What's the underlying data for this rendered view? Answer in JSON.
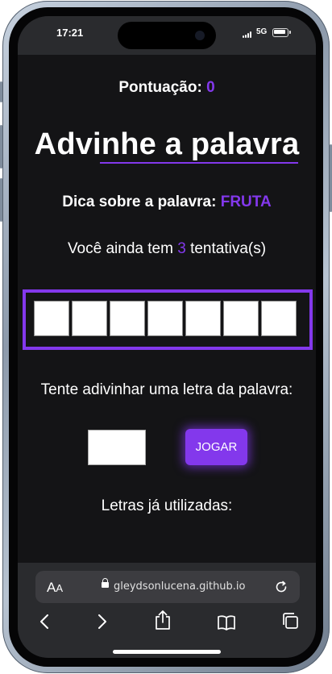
{
  "status_bar": {
    "time": "17:21",
    "network": "5G"
  },
  "game": {
    "score_label": "Pontuação:",
    "score_value": "0",
    "title": "Advinhe a palavra",
    "hint_label": "Dica sobre a palavra:",
    "hint_value": "FRUTA",
    "tries_prefix": "Você ainda tem",
    "tries_count": "3",
    "tries_suffix": "tentativa(s)",
    "word_length": 7,
    "guess_prompt": "Tente adivinhar uma letra da palavra:",
    "letter_input_value": "",
    "play_button": "JOGAR",
    "used_letters_label": "Letras já utilizadas:",
    "used_letters": ""
  },
  "browser": {
    "text_size_label": "AA",
    "url": "gleydsonlucena.github.io",
    "icons": [
      "reload-icon",
      "back-icon",
      "forward-icon",
      "share-icon",
      "bookmarks-icon",
      "tabs-icon"
    ]
  },
  "colors": {
    "accent": "#8338ec",
    "background": "#141416",
    "chrome": "#2a2b2e"
  }
}
